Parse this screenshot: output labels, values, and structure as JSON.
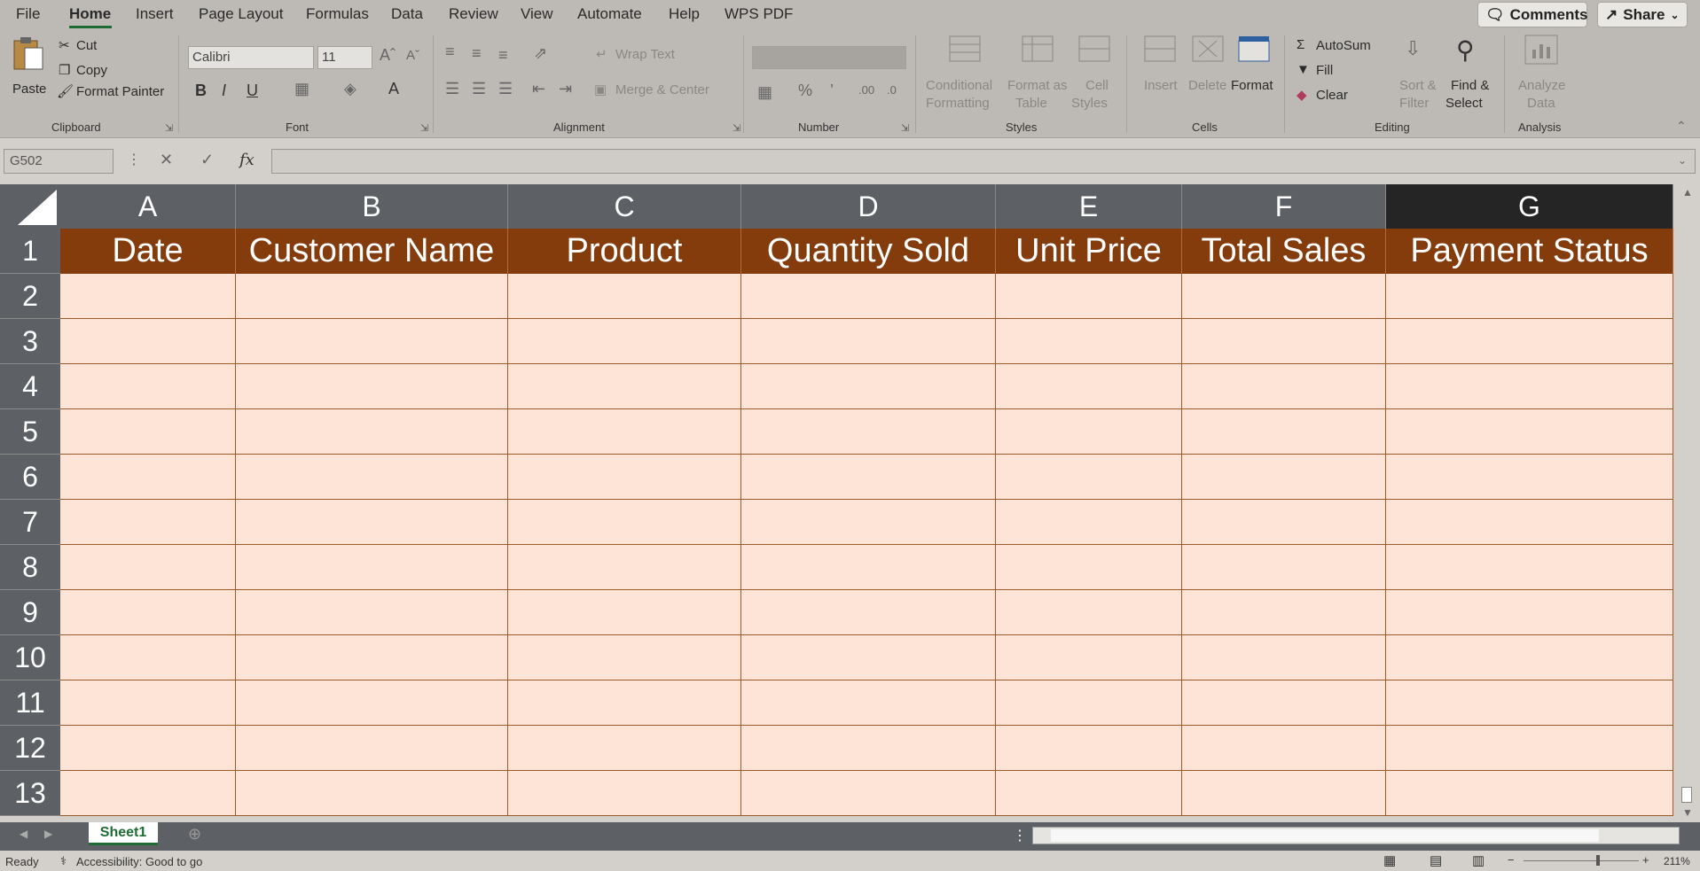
{
  "menu": {
    "file": "File",
    "home": "Home",
    "insert": "Insert",
    "page_layout": "Page Layout",
    "formulas": "Formulas",
    "data": "Data",
    "review": "Review",
    "view": "View",
    "automate": "Automate",
    "help": "Help",
    "wps_pdf": "WPS PDF",
    "comments": "Comments",
    "share": "Share"
  },
  "ribbon": {
    "clipboard": {
      "label": "Clipboard",
      "paste": "Paste",
      "cut": "Cut",
      "copy": "Copy",
      "format_painter": "Format Painter"
    },
    "font": {
      "label": "Font",
      "family": "Calibri",
      "size": "11"
    },
    "alignment": {
      "label": "Alignment",
      "wrap_text": "Wrap Text",
      "merge_center": "Merge & Center"
    },
    "number": {
      "label": "Number"
    },
    "styles": {
      "label": "Styles",
      "conditional_formatting_1": "Conditional",
      "conditional_formatting_2": "Formatting",
      "format_as_table_1": "Format as",
      "format_as_table_2": "Table",
      "cell_styles_1": "Cell",
      "cell_styles_2": "Styles"
    },
    "cells": {
      "label": "Cells",
      "insert": "Insert",
      "delete": "Delete",
      "format": "Format"
    },
    "editing": {
      "label": "Editing",
      "autosum": "AutoSum",
      "fill": "Fill",
      "clear": "Clear",
      "sort_filter_1": "Sort &",
      "sort_filter_2": "Filter",
      "find_select_1": "Find &",
      "find_select_2": "Select"
    },
    "analysis": {
      "label": "Analysis",
      "analyze_1": "Analyze",
      "analyze_2": "Data"
    }
  },
  "formula_bar": {
    "name_box": "G502",
    "formula": ""
  },
  "sheet": {
    "columns": [
      "A",
      "B",
      "C",
      "D",
      "E",
      "F",
      "G"
    ],
    "selected_column": "G",
    "headers": [
      "Date",
      "Customer Name",
      "Product",
      "Quantity Sold",
      "Unit Price",
      "Total Sales",
      "Payment Status"
    ],
    "rows": [
      "1",
      "2",
      "3",
      "4",
      "5",
      "6",
      "7",
      "8",
      "9",
      "10",
      "11",
      "12",
      "13"
    ],
    "header_fill": "#843c0c",
    "body_fill": "#fde4d6"
  },
  "sheet_tabs": [
    "Sheet1"
  ],
  "status": {
    "ready": "Ready",
    "accessibility": "Accessibility: Good to go",
    "zoom": "211%"
  }
}
